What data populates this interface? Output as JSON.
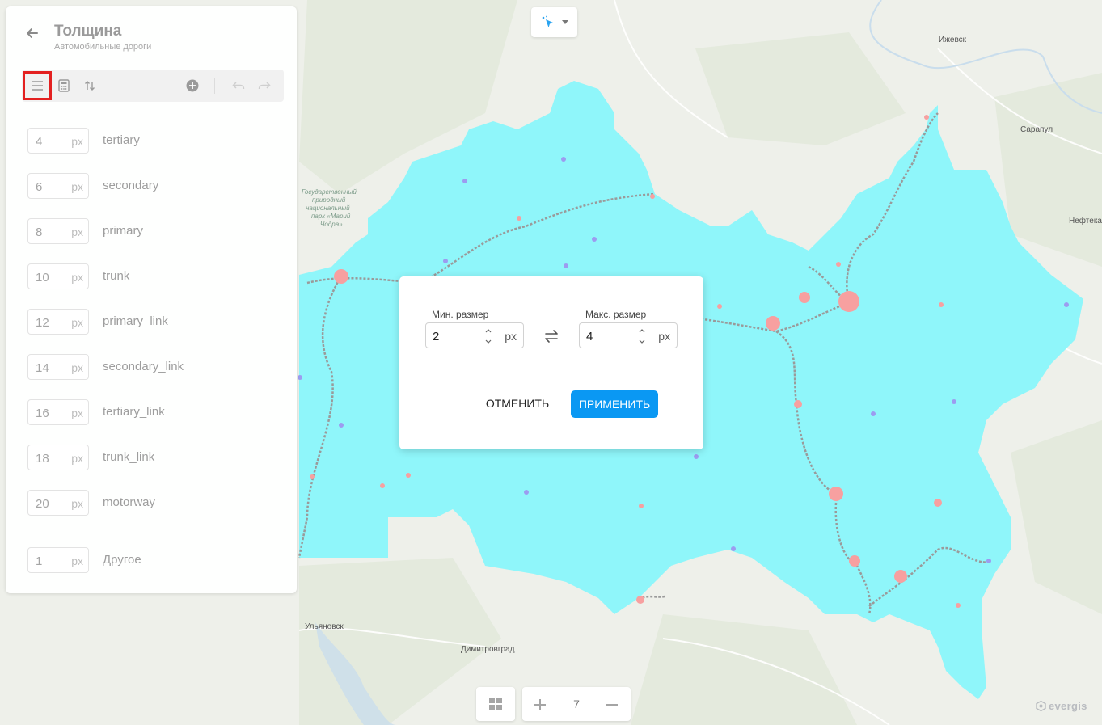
{
  "panel": {
    "title": "Толщина",
    "subtitle": "Автомобильные дороги",
    "rows": [
      {
        "value": "4",
        "unit": "px",
        "label": "tertiary"
      },
      {
        "value": "6",
        "unit": "px",
        "label": "secondary"
      },
      {
        "value": "8",
        "unit": "px",
        "label": "primary"
      },
      {
        "value": "10",
        "unit": "px",
        "label": "trunk"
      },
      {
        "value": "12",
        "unit": "px",
        "label": "primary_link"
      },
      {
        "value": "14",
        "unit": "px",
        "label": "secondary_link"
      },
      {
        "value": "16",
        "unit": "px",
        "label": "tertiary_link"
      },
      {
        "value": "18",
        "unit": "px",
        "label": "trunk_link"
      },
      {
        "value": "20",
        "unit": "px",
        "label": "motorway"
      }
    ],
    "other": {
      "value": "1",
      "unit": "px",
      "label": "Другое"
    }
  },
  "dialog": {
    "min_label": "Мин. размер",
    "min_value": "2",
    "min_unit": "px",
    "max_label": "Макс. размер",
    "max_value": "4",
    "max_unit": "px",
    "cancel_label": "ОТМЕНИТЬ",
    "apply_label": "ПРИМЕНИТЬ"
  },
  "map": {
    "cities": [
      "Ижевск",
      "Сарапул",
      "Нефтекам",
      "Ульяновск",
      "Димитровград"
    ],
    "park_label": [
      "Государственный",
      "природный",
      "национальный",
      "парк «Марий",
      "Чодра»"
    ],
    "region_color": "#8ff6fa",
    "point_color_red": "#f7a0a0",
    "point_color_blue": "#9c9cf0",
    "road_color": "#9a9a9a"
  },
  "zoom": {
    "level": "7"
  },
  "logo": {
    "text": "evergis"
  },
  "colors": {
    "accent": "#0a98f3",
    "highlight": "#e32020"
  }
}
